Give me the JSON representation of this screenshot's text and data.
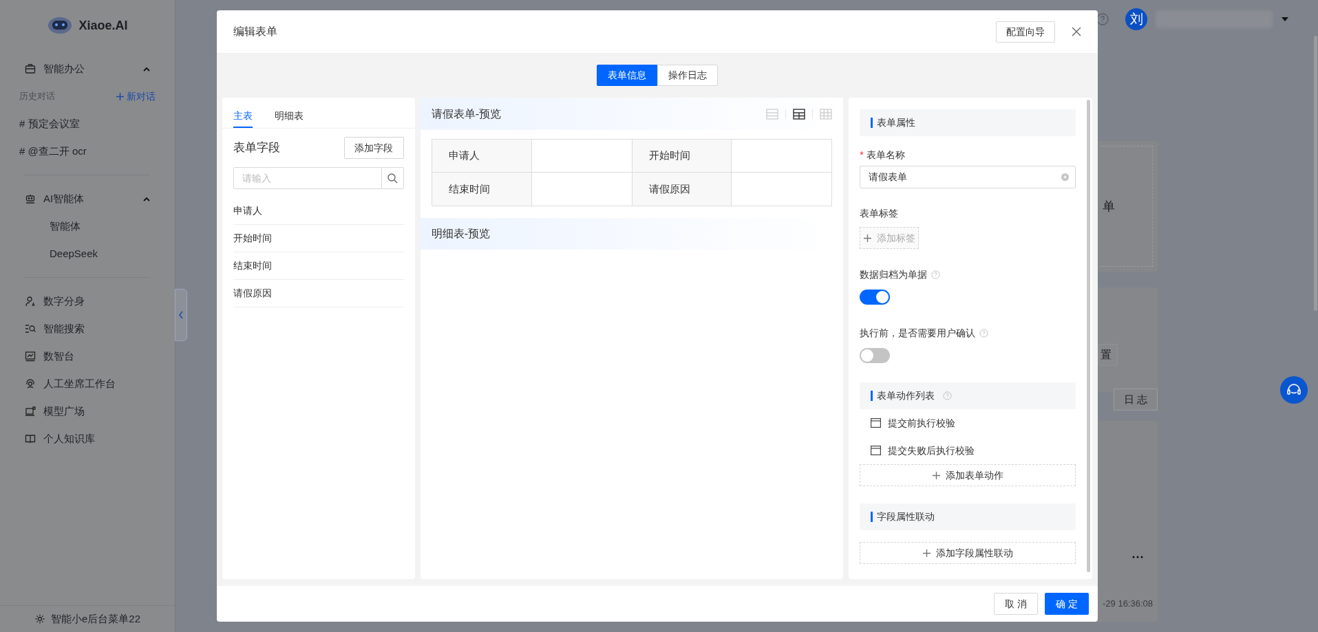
{
  "sidebar": {
    "logo": "Xiaoe.AI",
    "sections": [
      {
        "title": "智能办公",
        "expanded": true,
        "history_label": "历史对话",
        "new_chat": "新对话",
        "items": [
          "# 预定会议室",
          "# @查二开 ocr"
        ]
      },
      {
        "title": "AI智能体",
        "expanded": true,
        "items": [
          "智能体",
          "DeepSeek"
        ]
      }
    ],
    "nav": [
      "数字分身",
      "智能搜索",
      "数智台",
      "人工坐席工作台",
      "模型广场",
      "个人知识库"
    ],
    "footer": "智能小e后台菜单22"
  },
  "background": {
    "avatar": "刘",
    "card_text": "单",
    "partial_button": "置",
    "log_button": "日 志",
    "timestamp": "-29 16:36:08"
  },
  "modal": {
    "title": "编辑表单",
    "guide_button": "配置向导",
    "tabs": [
      {
        "label": "表单信息",
        "selected": true
      },
      {
        "label": "操作日志",
        "selected": false
      }
    ],
    "fields_panel": {
      "tabs": [
        {
          "label": "主表",
          "selected": true
        },
        {
          "label": "明细表",
          "selected": false
        }
      ],
      "heading": "表单字段",
      "add_button": "添加字段",
      "search": {
        "placeholder": "请输入"
      },
      "fields": [
        "申请人",
        "开始时间",
        "结束时间",
        "请假原因"
      ]
    },
    "preview": {
      "title": "请假表单-预览",
      "layout_options": [
        {
          "selected": false
        },
        {
          "selected": true
        },
        {
          "selected": false
        }
      ],
      "rows": [
        [
          "申请人",
          "开始时间"
        ],
        [
          "结束时间",
          "请假原因"
        ]
      ],
      "detail_title": "明细表-预览"
    },
    "properties": {
      "section_title": "表单属性",
      "required_mark": "*",
      "name_label": "表单名称",
      "name_value": "请假表单",
      "tags_label": "表单标签",
      "add_tag": "添加标签",
      "toggles": [
        {
          "label": "数据归档为单据",
          "on": true
        },
        {
          "label": "执行前，是否需要用户确认",
          "on": false
        }
      ],
      "actions_title": "表单动作列表",
      "actions": [
        "提交前执行校验",
        "提交失败后执行校验"
      ],
      "add_action": "添加表单动作",
      "linkage_title": "字段属性联动",
      "add_linkage": "添加字段属性联动"
    },
    "buttons": {
      "cancel": "取 消",
      "ok": "确 定"
    }
  }
}
